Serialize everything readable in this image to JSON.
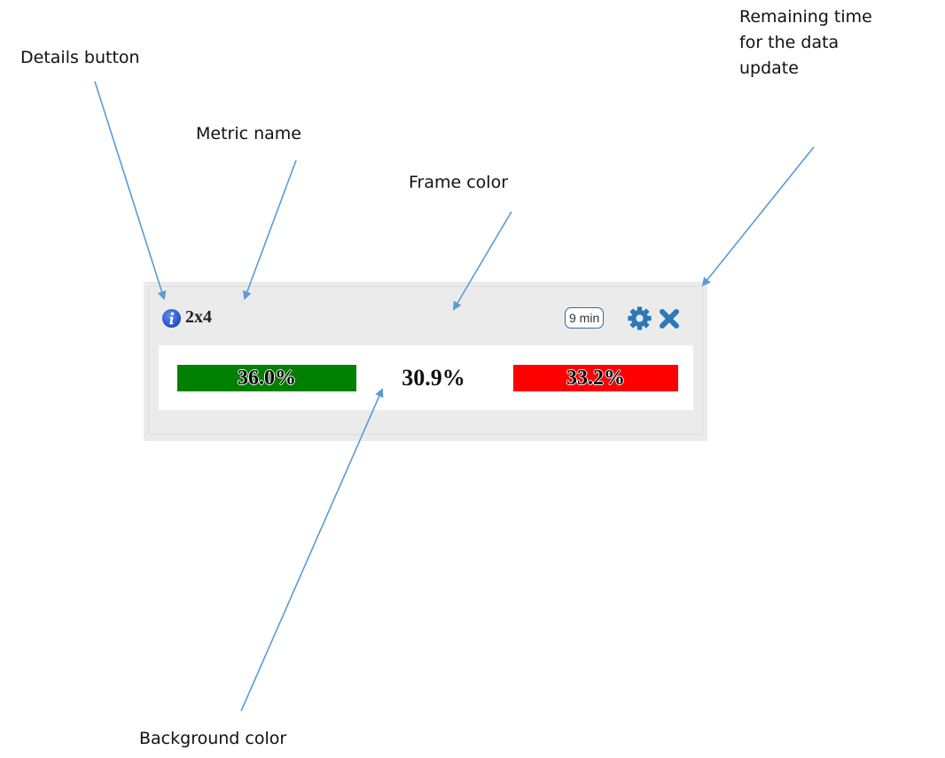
{
  "annotations": {
    "details_button": "Details button",
    "metric_name": "Metric name",
    "frame_color": "Frame color",
    "remaining_time": [
      "Remaining time",
      "for the data",
      "update"
    ],
    "background_color": "Background color"
  },
  "widget": {
    "metric_name": "2x4",
    "timer": "9 min",
    "info_icon": "info-icon",
    "settings_icon": "gear-icon",
    "close_icon": "close-icon",
    "frame_color": "#ebebeb",
    "background_color": "#ffffff",
    "values": {
      "left": {
        "text": "36.0%",
        "color": "#008000"
      },
      "center": {
        "text": "30.9%"
      },
      "right": {
        "text": "33.2%",
        "color": "#ff0000"
      }
    }
  },
  "colors": {
    "arrow": "#5b9bd5",
    "icon_blue": "#2f78b8",
    "info_blue": "#2a5fd0"
  }
}
